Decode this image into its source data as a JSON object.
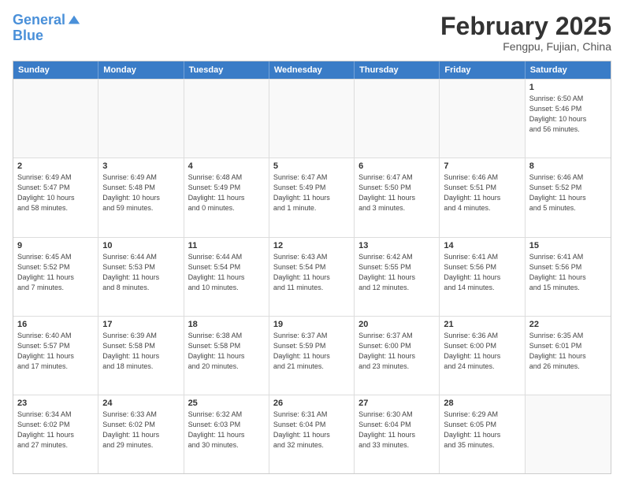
{
  "header": {
    "logo_line1": "General",
    "logo_line2": "Blue",
    "month_title": "February 2025",
    "subtitle": "Fengpu, Fujian, China"
  },
  "weekdays": [
    "Sunday",
    "Monday",
    "Tuesday",
    "Wednesday",
    "Thursday",
    "Friday",
    "Saturday"
  ],
  "rows": [
    [
      {
        "day": "",
        "info": ""
      },
      {
        "day": "",
        "info": ""
      },
      {
        "day": "",
        "info": ""
      },
      {
        "day": "",
        "info": ""
      },
      {
        "day": "",
        "info": ""
      },
      {
        "day": "",
        "info": ""
      },
      {
        "day": "1",
        "info": "Sunrise: 6:50 AM\nSunset: 5:46 PM\nDaylight: 10 hours\nand 56 minutes."
      }
    ],
    [
      {
        "day": "2",
        "info": "Sunrise: 6:49 AM\nSunset: 5:47 PM\nDaylight: 10 hours\nand 58 minutes."
      },
      {
        "day": "3",
        "info": "Sunrise: 6:49 AM\nSunset: 5:48 PM\nDaylight: 10 hours\nand 59 minutes."
      },
      {
        "day": "4",
        "info": "Sunrise: 6:48 AM\nSunset: 5:49 PM\nDaylight: 11 hours\nand 0 minutes."
      },
      {
        "day": "5",
        "info": "Sunrise: 6:47 AM\nSunset: 5:49 PM\nDaylight: 11 hours\nand 1 minute."
      },
      {
        "day": "6",
        "info": "Sunrise: 6:47 AM\nSunset: 5:50 PM\nDaylight: 11 hours\nand 3 minutes."
      },
      {
        "day": "7",
        "info": "Sunrise: 6:46 AM\nSunset: 5:51 PM\nDaylight: 11 hours\nand 4 minutes."
      },
      {
        "day": "8",
        "info": "Sunrise: 6:46 AM\nSunset: 5:52 PM\nDaylight: 11 hours\nand 5 minutes."
      }
    ],
    [
      {
        "day": "9",
        "info": "Sunrise: 6:45 AM\nSunset: 5:52 PM\nDaylight: 11 hours\nand 7 minutes."
      },
      {
        "day": "10",
        "info": "Sunrise: 6:44 AM\nSunset: 5:53 PM\nDaylight: 11 hours\nand 8 minutes."
      },
      {
        "day": "11",
        "info": "Sunrise: 6:44 AM\nSunset: 5:54 PM\nDaylight: 11 hours\nand 10 minutes."
      },
      {
        "day": "12",
        "info": "Sunrise: 6:43 AM\nSunset: 5:54 PM\nDaylight: 11 hours\nand 11 minutes."
      },
      {
        "day": "13",
        "info": "Sunrise: 6:42 AM\nSunset: 5:55 PM\nDaylight: 11 hours\nand 12 minutes."
      },
      {
        "day": "14",
        "info": "Sunrise: 6:41 AM\nSunset: 5:56 PM\nDaylight: 11 hours\nand 14 minutes."
      },
      {
        "day": "15",
        "info": "Sunrise: 6:41 AM\nSunset: 5:56 PM\nDaylight: 11 hours\nand 15 minutes."
      }
    ],
    [
      {
        "day": "16",
        "info": "Sunrise: 6:40 AM\nSunset: 5:57 PM\nDaylight: 11 hours\nand 17 minutes."
      },
      {
        "day": "17",
        "info": "Sunrise: 6:39 AM\nSunset: 5:58 PM\nDaylight: 11 hours\nand 18 minutes."
      },
      {
        "day": "18",
        "info": "Sunrise: 6:38 AM\nSunset: 5:58 PM\nDaylight: 11 hours\nand 20 minutes."
      },
      {
        "day": "19",
        "info": "Sunrise: 6:37 AM\nSunset: 5:59 PM\nDaylight: 11 hours\nand 21 minutes."
      },
      {
        "day": "20",
        "info": "Sunrise: 6:37 AM\nSunset: 6:00 PM\nDaylight: 11 hours\nand 23 minutes."
      },
      {
        "day": "21",
        "info": "Sunrise: 6:36 AM\nSunset: 6:00 PM\nDaylight: 11 hours\nand 24 minutes."
      },
      {
        "day": "22",
        "info": "Sunrise: 6:35 AM\nSunset: 6:01 PM\nDaylight: 11 hours\nand 26 minutes."
      }
    ],
    [
      {
        "day": "23",
        "info": "Sunrise: 6:34 AM\nSunset: 6:02 PM\nDaylight: 11 hours\nand 27 minutes."
      },
      {
        "day": "24",
        "info": "Sunrise: 6:33 AM\nSunset: 6:02 PM\nDaylight: 11 hours\nand 29 minutes."
      },
      {
        "day": "25",
        "info": "Sunrise: 6:32 AM\nSunset: 6:03 PM\nDaylight: 11 hours\nand 30 minutes."
      },
      {
        "day": "26",
        "info": "Sunrise: 6:31 AM\nSunset: 6:04 PM\nDaylight: 11 hours\nand 32 minutes."
      },
      {
        "day": "27",
        "info": "Sunrise: 6:30 AM\nSunset: 6:04 PM\nDaylight: 11 hours\nand 33 minutes."
      },
      {
        "day": "28",
        "info": "Sunrise: 6:29 AM\nSunset: 6:05 PM\nDaylight: 11 hours\nand 35 minutes."
      },
      {
        "day": "",
        "info": ""
      }
    ]
  ]
}
